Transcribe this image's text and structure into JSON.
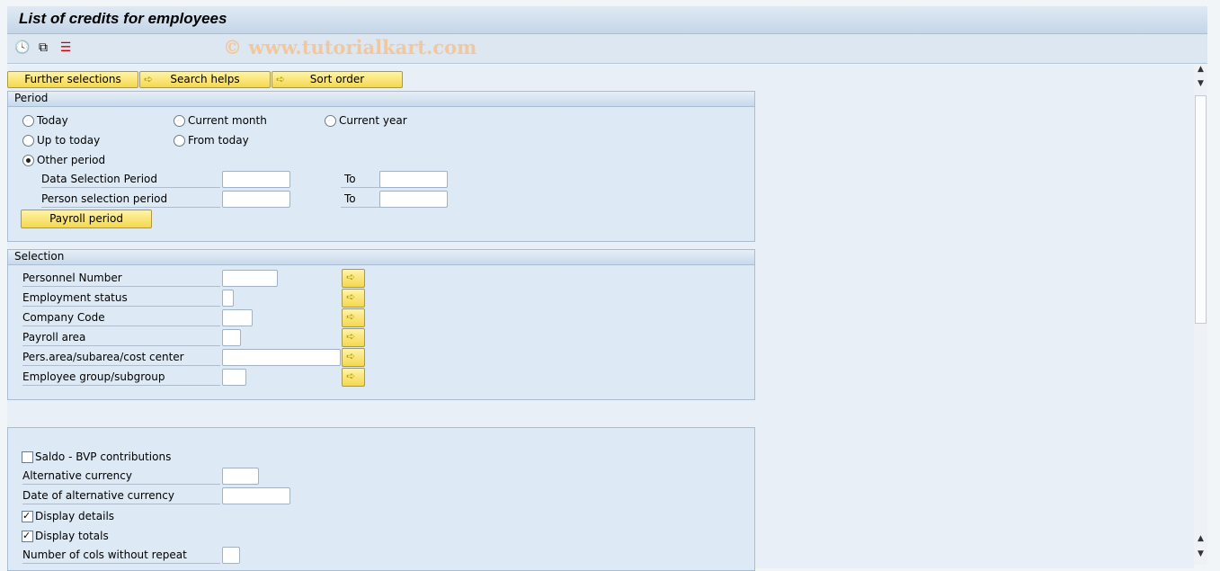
{
  "title": "List of credits for employees",
  "watermark": "© www.tutorialkart.com",
  "toolbar": {
    "icons": [
      "execute-icon",
      "get-variant-icon",
      "selection-options-icon"
    ]
  },
  "buttons": {
    "further": "Further selections",
    "search": "Search helps",
    "sort": "Sort order"
  },
  "period": {
    "title": "Period",
    "radios": [
      {
        "label": "Today",
        "selected": false
      },
      {
        "label": "Current month",
        "selected": false
      },
      {
        "label": "Current year",
        "selected": false
      },
      {
        "label": "Up to today",
        "selected": false
      },
      {
        "label": "From today",
        "selected": false
      },
      {
        "label": "Other period",
        "selected": true
      }
    ],
    "data_sel": "Data Selection Period",
    "person_sel": "Person selection period",
    "to": "To",
    "payroll_btn": "Payroll period"
  },
  "selection": {
    "title": "Selection",
    "rows": [
      "Personnel Number",
      "Employment status",
      "Company Code",
      "Payroll area",
      "Pers.area/subarea/cost center",
      "Employee group/subgroup"
    ]
  },
  "options": {
    "saldo": "Saldo - BVP contributions",
    "saldo_checked": false,
    "alt_currency": "Alternative currency",
    "alt_date": "Date of alternative currency",
    "details": "Display details",
    "details_checked": true,
    "totals": "Display totals",
    "totals_checked": true,
    "cols": "Number of cols without repeat"
  },
  "colors": {
    "button": "#f5d84f",
    "group_bg": "#dde9f4"
  }
}
